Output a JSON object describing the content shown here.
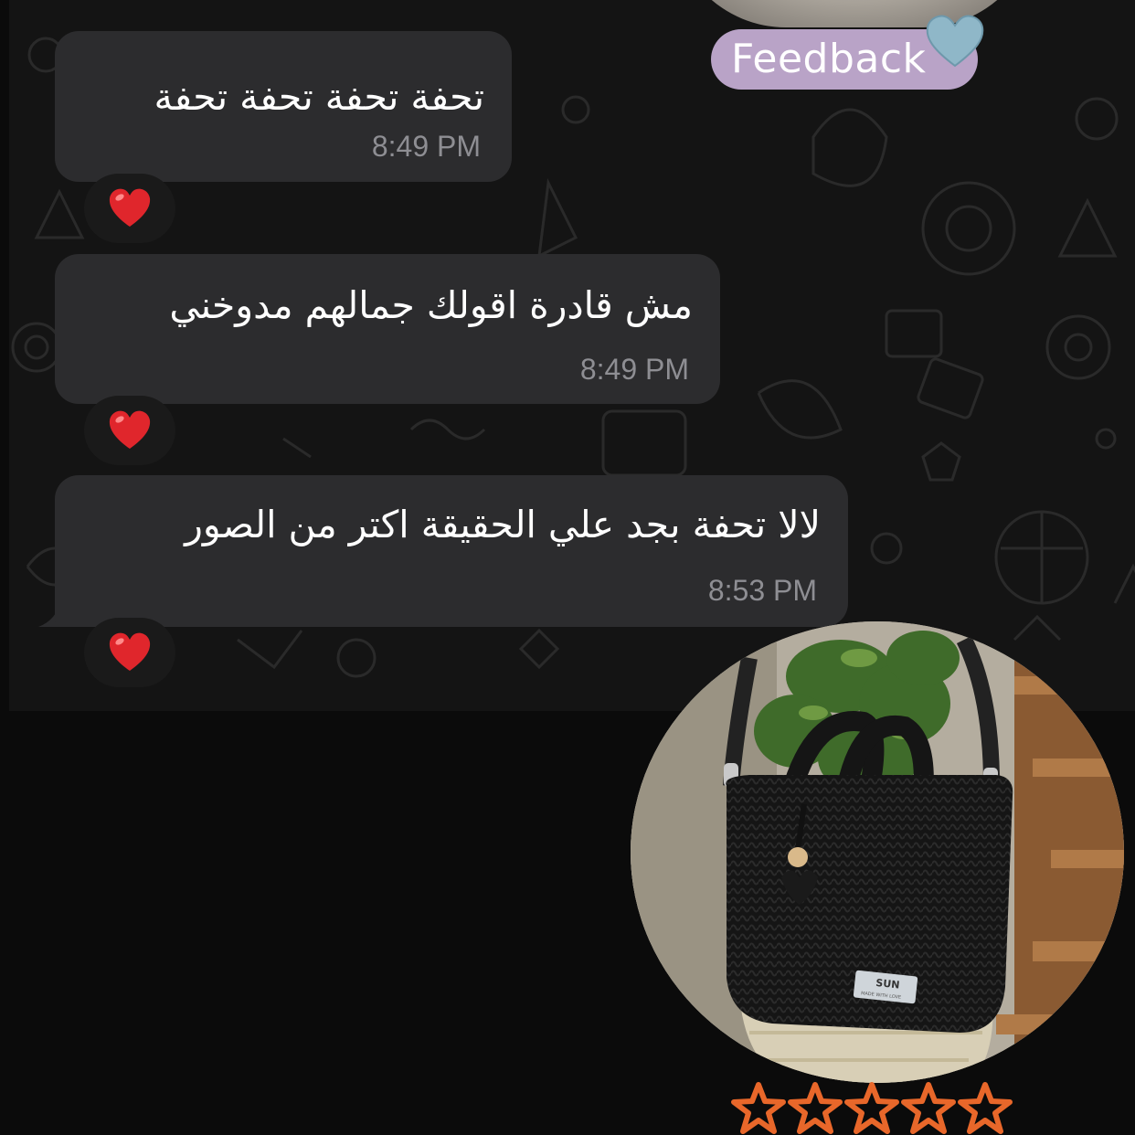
{
  "header": {
    "feedback_label": "Feedback",
    "heart_icon": "light-blue-heart-icon"
  },
  "messages": [
    {
      "text": "تحفة تحفة تحفة تحفة",
      "time": "8:49 PM",
      "reaction": "red-heart-icon"
    },
    {
      "text": "مش قادرة اقولك جمالهم مدوخني",
      "time": "8:49 PM",
      "reaction": "red-heart-icon"
    },
    {
      "text": "لالا تحفة بجد علي الحقيقة اكتر من الصور",
      "time": "8:53 PM",
      "reaction": "red-heart-icon"
    }
  ],
  "product": {
    "label_brand": "SUN",
    "label_tagline": "MADE WITH LOVE",
    "image_icon": "crochet-bag-photo"
  },
  "rating": {
    "stars": 5,
    "max": 5,
    "star_color": "#e8672a"
  },
  "colors": {
    "background": "#0b0b0b",
    "chat_background": "#141414",
    "bubble": "#2c2c2e",
    "time": "#8e8e93",
    "feedback_badge": "#b9a3c7",
    "heart": "#e0262c"
  }
}
